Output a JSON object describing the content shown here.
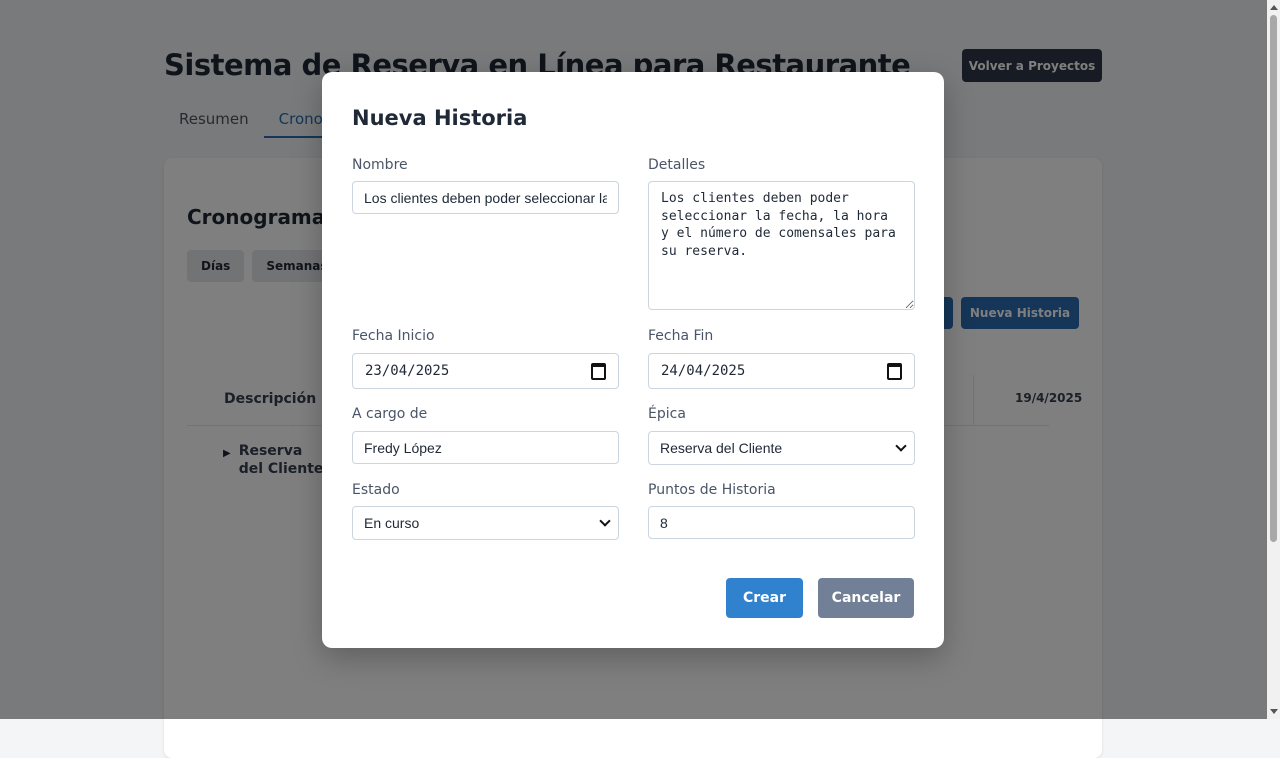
{
  "page": {
    "title": "Sistema de Reserva en Línea para Restaurante",
    "back_button": "Volver a Proyectos",
    "tabs": [
      {
        "label": "Resumen"
      },
      {
        "label": "Cronograma"
      }
    ]
  },
  "card": {
    "title": "Cronograma",
    "view_buttons": [
      "Días",
      "Semanas"
    ],
    "new_story_button": "Nueva Historia",
    "gantt": {
      "column_header": "Descripción",
      "date_header": "19/4/2025",
      "rows": [
        {
          "label": "Reserva del Cliente"
        }
      ]
    }
  },
  "modal": {
    "title": "Nueva Historia",
    "fields": {
      "nombre": {
        "label": "Nombre",
        "value": "Los clientes deben poder seleccionar la fecha, la hora y el número de comensales para su reserva."
      },
      "detalles": {
        "label": "Detalles",
        "value": "Los clientes deben poder seleccionar la fecha, la hora y el número de comensales para su reserva."
      },
      "fecha_inicio": {
        "label": "Fecha Inicio",
        "value": "23/04/2025"
      },
      "fecha_fin": {
        "label": "Fecha Fin",
        "value": "24/04/2025"
      },
      "a_cargo": {
        "label": "A cargo de",
        "value": "Fredy López"
      },
      "epica": {
        "label": "Épica",
        "value": "Reserva del Cliente"
      },
      "estado": {
        "label": "Estado",
        "value": "En curso"
      },
      "puntos": {
        "label": "Puntos de Historia",
        "value": "8"
      }
    },
    "buttons": {
      "create": "Crear",
      "cancel": "Cancelar"
    }
  },
  "colors": {
    "primary": "#3182ce",
    "tab_active": "#2b6cb0",
    "dark_button": "#2d3748",
    "cancel_button": "#718096",
    "overlay": "rgba(0,0,0,0.5)"
  },
  "icons": [
    "calendar-icon",
    "chevron-down-icon",
    "triangle-right-icon"
  ]
}
